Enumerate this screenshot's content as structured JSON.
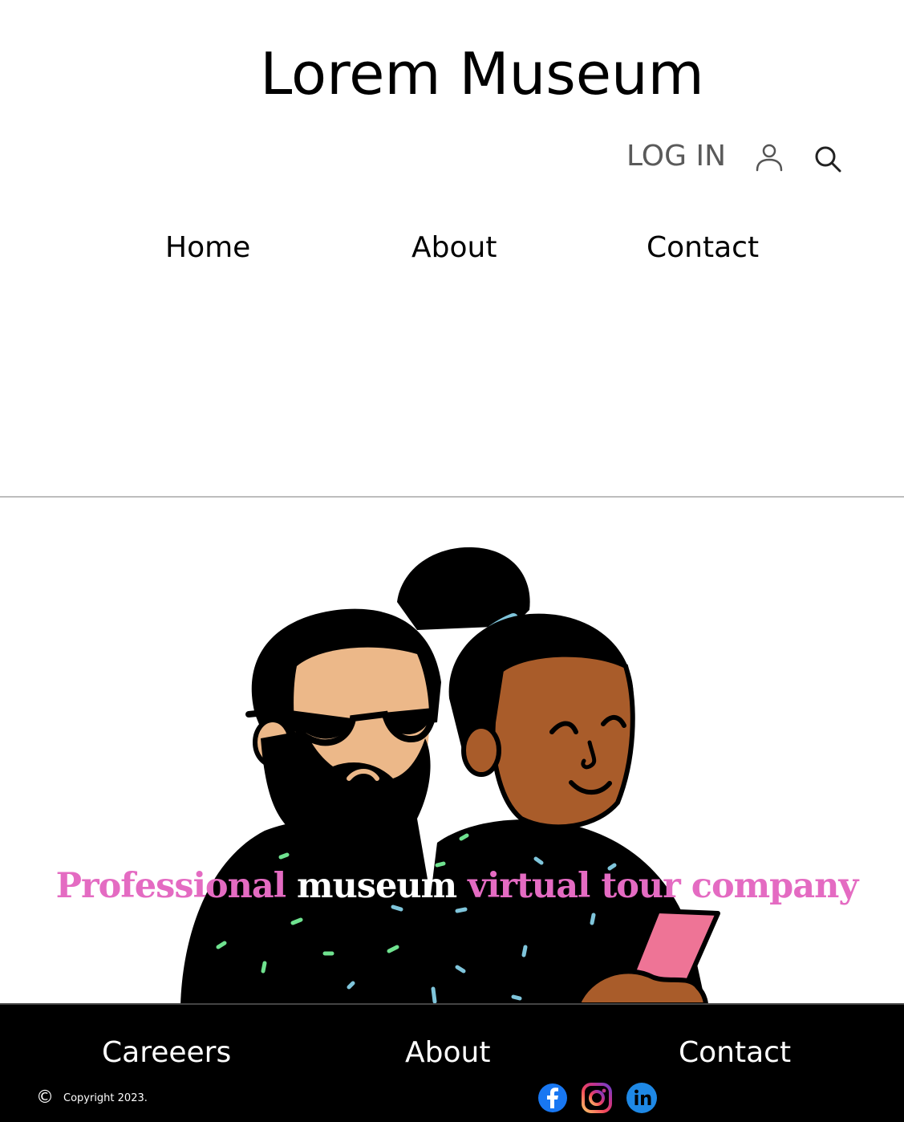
{
  "header": {
    "site_title": "Lorem Museum",
    "login_label": "LOG IN",
    "user_icon": "user-icon",
    "search_icon": "search-icon"
  },
  "nav": {
    "items": [
      {
        "label": "Home"
      },
      {
        "label": "About"
      },
      {
        "label": "Contact"
      }
    ]
  },
  "hero": {
    "tagline_part1": "Professional ",
    "tagline_accent": "museum",
    "tagline_part2": " virtual tour company",
    "illustration": "two-people-looking-at-phone-illustration"
  },
  "footer": {
    "links": [
      {
        "label": "Careeers"
      },
      {
        "label": "About"
      },
      {
        "label": "Contact"
      }
    ],
    "copyright_symbol": "©",
    "copyright_text": "Copyright 2023.",
    "social": [
      "facebook-icon",
      "instagram-icon",
      "linkedin-icon"
    ]
  },
  "colors": {
    "tagline_pink": "#e46bc2",
    "tagline_accent": "#ffffff",
    "footer_bg": "#000000",
    "login_gray": "#5a5a5a",
    "facebook_blue": "#1877f2",
    "linkedin_blue": "#1e88e5"
  }
}
